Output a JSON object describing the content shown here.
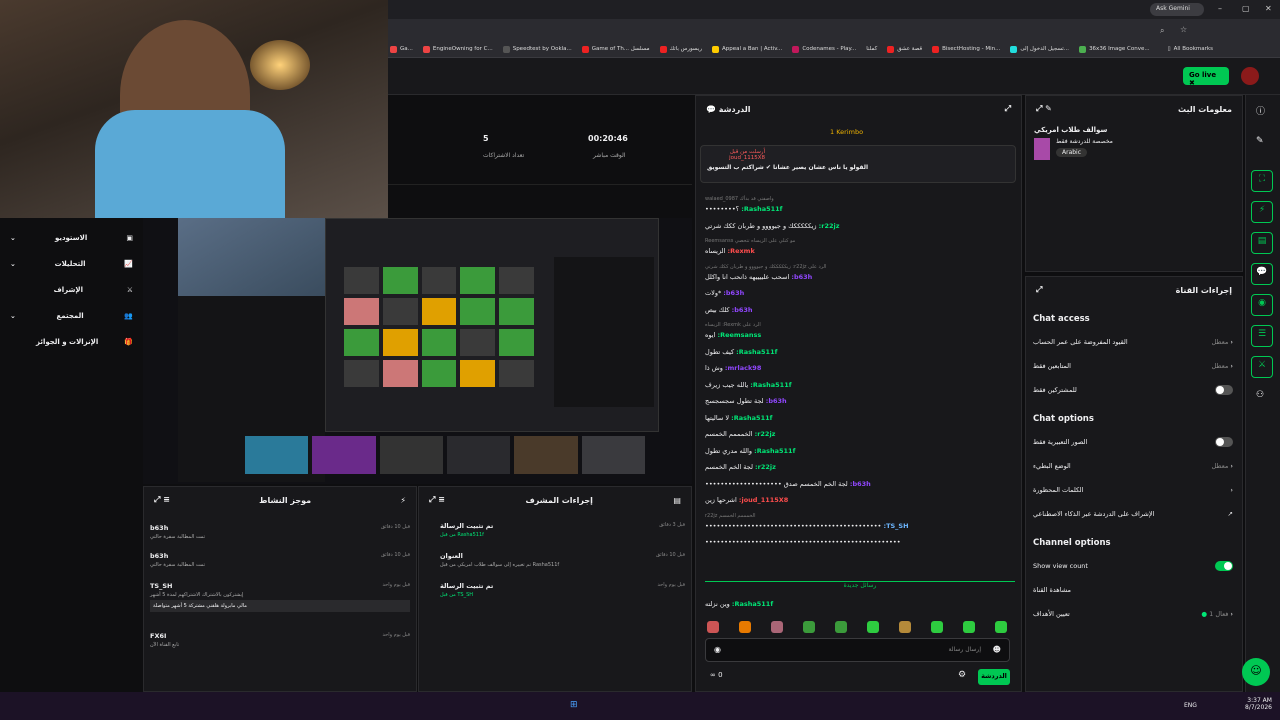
{
  "browser": {
    "ask_gemini": "Ask Gemini",
    "all_bookmarks": "All Bookmarks",
    "bookmarks": [
      "Ga...",
      "EngineOwning for C...",
      "Speedtest by Ookla...",
      "Game of Th... مسلسل",
      "ريسورس باتك",
      "Appeal a Ban | Activ...",
      "Codenames - Play...",
      "كملنا",
      "قصة عشق",
      "BisectHosting - Min...",
      "تسجيل الدخول إلى...",
      "36x36 Image Conve..."
    ]
  },
  "topbar": {
    "go_live": "Go live"
  },
  "left_nav": [
    {
      "label": "الاستوديو"
    },
    {
      "label": "التحليلات"
    },
    {
      "label": "الإشراف"
    },
    {
      "label": "المجتمع"
    },
    {
      "label": "الإنزالات و الجوائز"
    }
  ],
  "stats": [
    {
      "value": "00:20:46",
      "label": "الوقت مباشر"
    },
    {
      "value": "5",
      "label": "تعداد الاشتراكات"
    }
  ],
  "chat": {
    "title": "الدردشة",
    "pinned_by": "Kerimbo",
    "pinned_count": "1",
    "pinned_header": "أرسلت من قبل joud_1115X8",
    "pinned_text": "القولو يا ناس عشان يصير عشانا ✔ شراكتم ب التسويق",
    "lines": [
      {
        "meta": "واصفتي قد بدأك walaed_0987",
        "user": "Rasha511f:",
        "msg": "؟••••••••",
        "ucolor": "#00e676"
      },
      {
        "user": "r22jz:",
        "msg": "زيكككككك و جيوووو و طربان ككك شرتي",
        "ucolor": "#00e676"
      },
      {
        "meta": "مو كنلي على الزيساه تتحصي Reemsanss",
        "user": "Rexmk:",
        "msg": "الزيساه",
        "ucolor": "#ff4d4d"
      },
      {
        "meta": "الرد على r22jz: زيكككككك و جيوووو و طربان ككك شرتي",
        "user": "b63h:",
        "msg": "اسحب علييييهه ذانحب انا واكلل",
        "ucolor": "#9147ff"
      },
      {
        "user": "b63h:",
        "msg": "*ولات",
        "ucolor": "#9147ff"
      },
      {
        "user": "b63h:",
        "msg": "كلك بيص",
        "ucolor": "#9147ff"
      },
      {
        "meta": "الرد على Rexmk: الزيساه",
        "user": "Reemsanss:",
        "msg": "ايوه",
        "ucolor": "#00e676"
      },
      {
        "user": "Rasha511f:",
        "msg": "كيف تطول",
        "ucolor": "#00e676"
      },
      {
        "user": "mrlack98:",
        "msg": "وش ذا",
        "ucolor": "#9147ff"
      },
      {
        "user": "Rasha511f:",
        "msg": "يالله جيب زيرف",
        "ucolor": "#00e676"
      },
      {
        "user": "b63h:",
        "msg": "لجة تطول سجسجسج",
        "ucolor": "#9147ff"
      },
      {
        "user": "Rasha511f:",
        "msg": "لا ساليتها",
        "ucolor": "#00e676"
      },
      {
        "user": "r22jz:",
        "msg": "الخمممم الخمسم",
        "ucolor": "#00e676"
      },
      {
        "user": "Rasha511f:",
        "msg": "والله مدري تطول",
        "ucolor": "#00e676"
      },
      {
        "user": "r22jz:",
        "msg": "لجة الخم الخمسم",
        "ucolor": "#00e676"
      },
      {
        "user": "b63h:",
        "msg": "لجة الخم الخمسم صدق ••••••••••••••••••••",
        "ucolor": "#9147ff"
      },
      {
        "user": "joud_1115X8:",
        "msg": "اشرحها زين",
        "ucolor": "#ff4d4d"
      },
      {
        "meta": "الخمممم الخمسم r22jz",
        "user": "TS_SH:",
        "msg": "••••••••••••••••••••••••••••••••••••••••••••••",
        "ucolor": "#6cb6ff"
      },
      {
        "user": "",
        "msg": "•••••••••••••••••••••••••••••••••••••••••••••••••••",
        "ucolor": "#fff"
      }
    ],
    "new_messages": "رسائل جديدة",
    "last_line": {
      "user": "Rasha511f:",
      "msg": "وين نزلته"
    },
    "input_placeholder": "إرسال رسالة",
    "send_label": "الدردشة",
    "viewer_count": "0"
  },
  "stream_info": {
    "title": "معلومات البث",
    "stream_title": "سوالف طلاب امريكي",
    "category": "مخصصة للدردشة فقط",
    "tag": "Arabic"
  },
  "channel_actions": {
    "title": "إجراءات القناة",
    "chat_access": "Chat access",
    "access_rows": [
      {
        "label": "القيود المفروضة على عمر الحساب",
        "value": "معطل"
      },
      {
        "label": "المتابعين فقط",
        "value": "معطل"
      },
      {
        "label": "للمشتركين فقط",
        "value": ""
      }
    ],
    "chat_options": "Chat options",
    "option_rows": [
      {
        "label": "الصور التعبيرية فقط",
        "value": ""
      },
      {
        "label": "الوضع البطيء",
        "value": "معطل"
      },
      {
        "label": "الكلمات المحظورة",
        "value": ""
      },
      {
        "label": "الإشراف على الدردشة عبر الذكاء الاصطناعي",
        "value": ""
      }
    ],
    "channel_options": "Channel options",
    "channel_rows": [
      {
        "label": "Show view count",
        "value": ""
      },
      {
        "label": "مشاهدة القناة",
        "value": ""
      },
      {
        "label": "تعيين الأهداف",
        "value": "فعال 1"
      }
    ]
  },
  "activity": {
    "title": "موجز النشاط",
    "items": [
      {
        "user": "b63h",
        "detail": "تمت المطالبة سفرة حالتي",
        "time": "قبل 10 دقائق"
      },
      {
        "user": "b63h",
        "detail": "تمت المطالبة سفرة حالتي",
        "time": "قبل 10 دقائق"
      },
      {
        "user": "TS_SH",
        "detail": "إيشتركون بالاشتراك الاشتراكهم لمدة 5 أشهر",
        "extra": "مالي مابرولة هلقني مشتركة 5 أشهر متواصلة",
        "time": "قبل يوم واحد"
      },
      {
        "user": "FX6I",
        "detail": "تابع القناة الآن",
        "time": "قبل يوم واحد"
      }
    ]
  },
  "mod_actions": {
    "title": "إجراءات المشرف",
    "items": [
      {
        "action": "تم تثبيت الرسالة",
        "by": "من قبل Rasha511f",
        "time": "قبل 3 دقائق"
      },
      {
        "action": "العنوان",
        "by": "تم تغييره إلى سوالف طلاب امريكي من قبل Rasha511f",
        "time": "قبل 10 دقائق"
      },
      {
        "action": "تم تثبيت الرسالة",
        "by": "من قبل TS_SH",
        "time": "قبل يوم واحد"
      }
    ]
  },
  "taskbar": {
    "lang": "ENG",
    "time": "3:37 AM",
    "date": "8/7/2026"
  }
}
